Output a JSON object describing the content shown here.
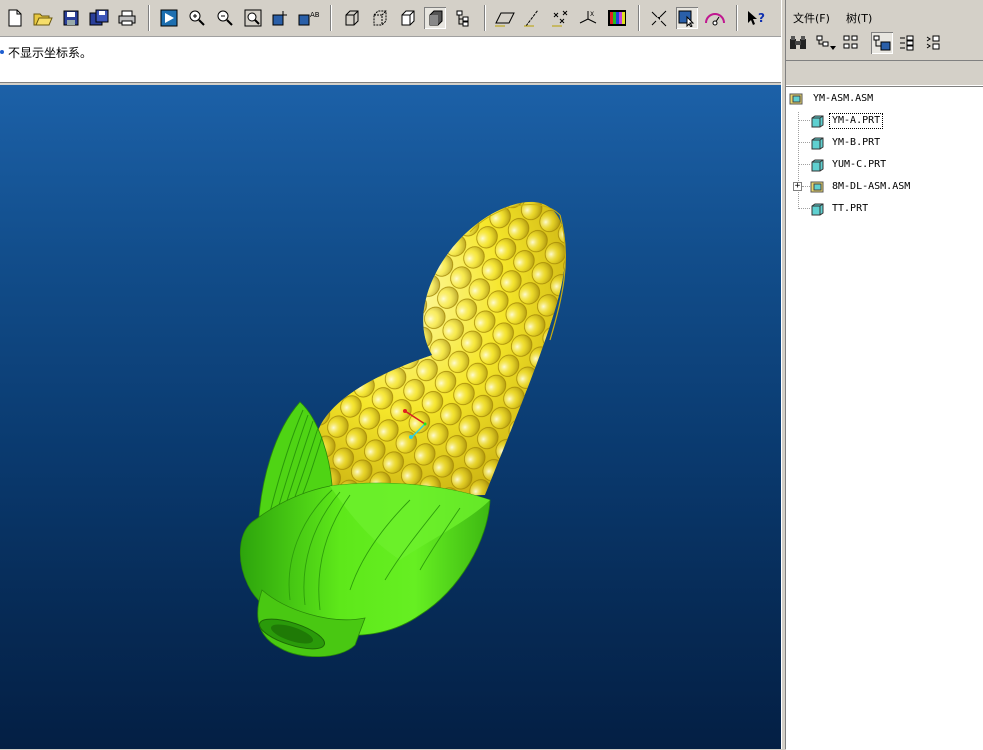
{
  "toolbar": {
    "icons": [
      "new-file-icon",
      "open-folder-icon",
      "save-icon",
      "save-copy-icon",
      "print-icon",
      "orient-icon",
      "zoom-in-icon",
      "zoom-out-icon",
      "refit-icon",
      "spin-center-icon",
      "named-view-icon",
      "wireframe-icon",
      "hidden-line-icon",
      "no-hidden-icon",
      "shading-icon",
      "model-tree-icon",
      "datum-plane-icon",
      "datum-axis-icon",
      "datum-point-icon",
      "coord-sys-icon",
      "color-appearance-icon",
      "select-filter-icon",
      "select-by-box-icon",
      "dynamic-view-icon",
      "whats-this-help-icon"
    ]
  },
  "message": {
    "text": "不显示坐标系。"
  },
  "colors": {
    "viewport_top": "#1c61a8",
    "viewport_bottom": "#041f44",
    "kernel_yellow": "#f5e62a",
    "husk_green": "#5ee81a"
  },
  "panel": {
    "menu": [
      {
        "label": "文件(F)"
      },
      {
        "label": "树(T)"
      }
    ],
    "tree": [
      {
        "label": "YM-ASM.ASM",
        "type": "assembly",
        "level": 0
      },
      {
        "label": "YM-A.PRT",
        "type": "part",
        "level": 1,
        "selected": true
      },
      {
        "label": "YM-B.PRT",
        "type": "part",
        "level": 1
      },
      {
        "label": "YUM-C.PRT",
        "type": "part",
        "level": 1
      },
      {
        "label": "8M-DL-ASM.ASM",
        "type": "assembly",
        "level": 1,
        "expandable": true
      },
      {
        "label": "TT.PRT",
        "type": "part",
        "level": 1
      }
    ]
  }
}
